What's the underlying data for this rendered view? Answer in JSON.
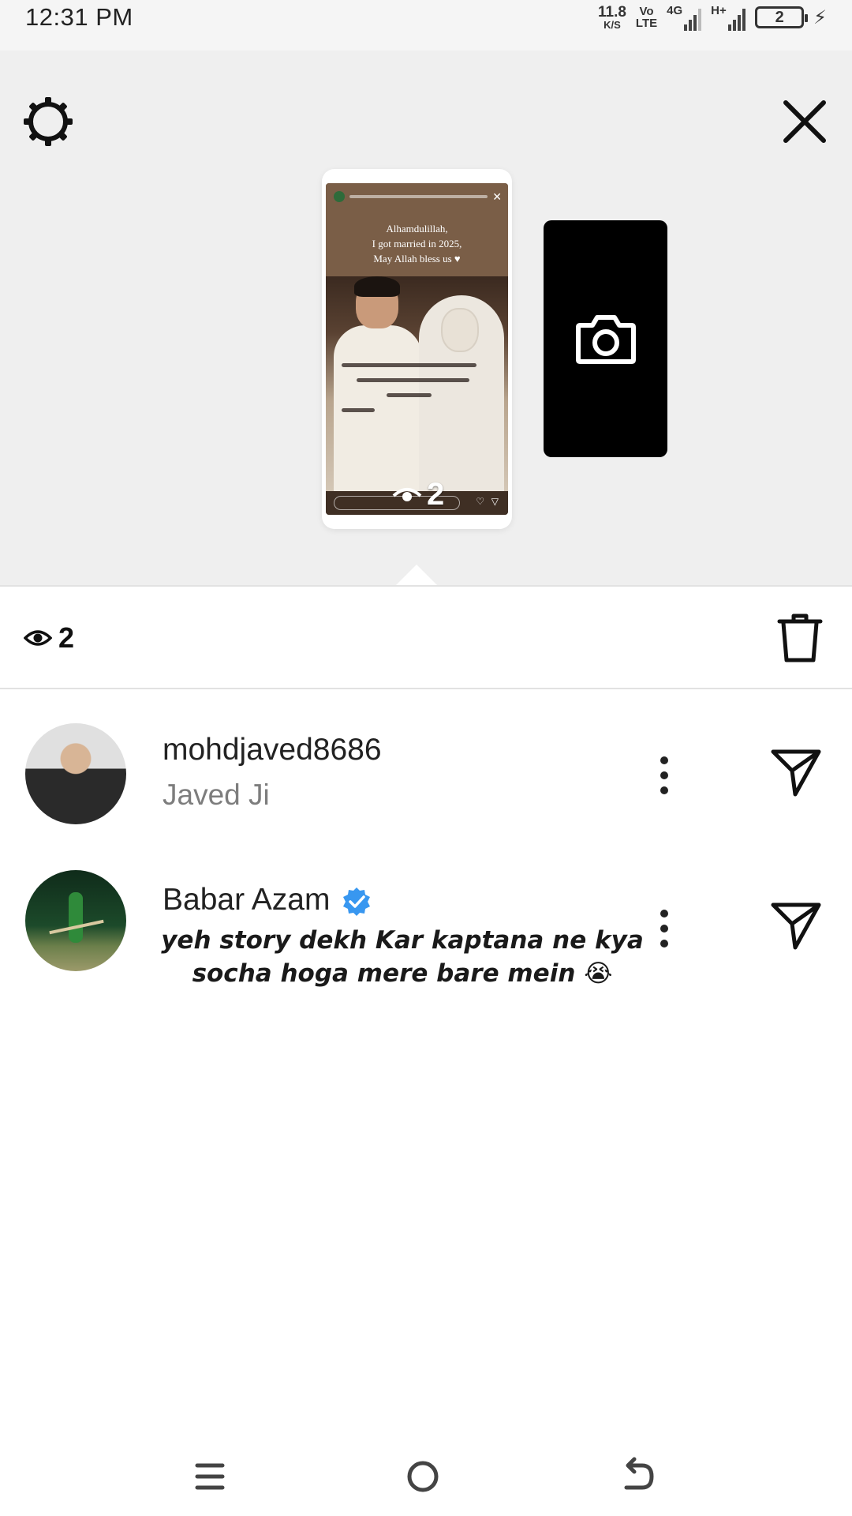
{
  "status_bar": {
    "time": "12:31 PM",
    "net_speed": "11.8",
    "net_unit": "K/S",
    "volte_top": "Vo",
    "volte_bottom": "LTE",
    "sim1_label": "4G",
    "sim2_label": "H+",
    "battery_level": "2"
  },
  "preview": {
    "settings_icon": "gear-icon",
    "close_icon": "close-icon",
    "story_caption": [
      "Alhamdulillah,",
      "I got married in 2025,",
      "May Allah bless us ♥"
    ],
    "story_view_count": "2",
    "camera_icon": "camera-icon"
  },
  "stats": {
    "view_count": "2",
    "eye_icon": "eye-icon",
    "delete_icon": "trash-icon"
  },
  "viewers": [
    {
      "username": "mohdjaved8686",
      "display_name": "Javed Ji",
      "verified": false
    },
    {
      "username": "Babar Azam",
      "display_name": "",
      "verified": true
    }
  ],
  "overlay_caption": [
    "yeh story dekh Kar kaptana ne kya",
    "socha hoga mere bare mein 😭"
  ],
  "colors": {
    "verified_badge": "#3897f0",
    "preview_bg": "#efefef",
    "camera_card": "#000000"
  },
  "nav_bar": {
    "menu_icon": "menu-icon",
    "home_icon": "home-icon",
    "back_icon": "back-icon"
  }
}
